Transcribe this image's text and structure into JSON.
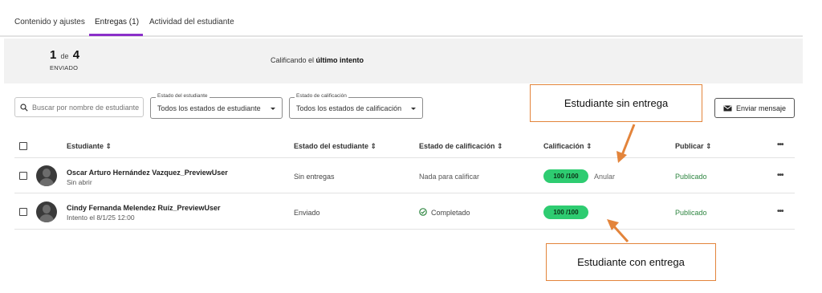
{
  "tabs": [
    {
      "label": "Contenido y ajustes"
    },
    {
      "label": "Entregas (1)"
    },
    {
      "label": "Actividad del estudiante"
    }
  ],
  "summary": {
    "current": "1",
    "de": "de",
    "total": "4",
    "status_label": "ENVIADO",
    "grading_prefix": "Calificando el",
    "grading_bold": "último intento"
  },
  "filters": {
    "search_placeholder": "Buscar por nombre de estudiante",
    "student_status": {
      "label": "Estado del estudiante",
      "value": "Todos los estados de estudiante"
    },
    "grade_status": {
      "label": "Estado de calificación",
      "value": "Todos los estados de calificación"
    },
    "send_message": "Enviar mensaje"
  },
  "table": {
    "headers": {
      "student": "Estudiante ⇕",
      "student_status": "Estado del estudiante ⇕",
      "grade_status": "Estado de calificación ⇕",
      "grade": "Calificación ⇕",
      "publish": "Publicar ⇕",
      "more": "•••"
    },
    "rows": [
      {
        "name": "Oscar Arturo Hernández Vazquez_PreviewUser",
        "sub": "Sin abrir",
        "student_status": "Sin entregas",
        "grade_status": "Nada para calificar",
        "grade": "100  /100",
        "grade_action": "Anular",
        "publish": "Publicado",
        "more": "•••"
      },
      {
        "name": "Cindy Fernanda Melendez Ruíz_PreviewUser",
        "sub": "Intento el 8/1/25 12:00",
        "student_status": "Enviado",
        "grade_status": "Completado",
        "grade": "100  /100",
        "publish": "Publicado",
        "more": "•••"
      }
    ]
  },
  "annotations": {
    "no_submission": "Estudiante sin entrega",
    "with_submission": "Estudiante con entrega"
  },
  "colors": {
    "accent": "#8b2fc9",
    "grade_pill": "#2ecc71",
    "published": "#2e8540",
    "callout": "#e3843b"
  }
}
